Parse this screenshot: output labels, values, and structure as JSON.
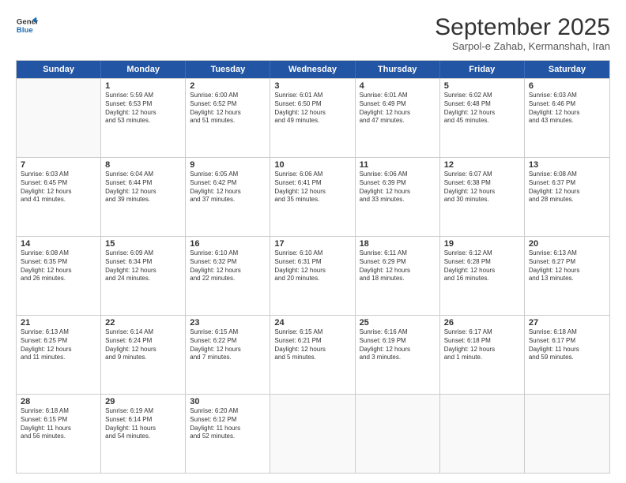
{
  "header": {
    "logo_line1": "General",
    "logo_line2": "Blue",
    "month": "September 2025",
    "location": "Sarpol-e Zahab, Kermanshah, Iran"
  },
  "weekdays": [
    "Sunday",
    "Monday",
    "Tuesday",
    "Wednesday",
    "Thursday",
    "Friday",
    "Saturday"
  ],
  "rows": [
    [
      {
        "day": "",
        "lines": []
      },
      {
        "day": "1",
        "lines": [
          "Sunrise: 5:59 AM",
          "Sunset: 6:53 PM",
          "Daylight: 12 hours",
          "and 53 minutes."
        ]
      },
      {
        "day": "2",
        "lines": [
          "Sunrise: 6:00 AM",
          "Sunset: 6:52 PM",
          "Daylight: 12 hours",
          "and 51 minutes."
        ]
      },
      {
        "day": "3",
        "lines": [
          "Sunrise: 6:01 AM",
          "Sunset: 6:50 PM",
          "Daylight: 12 hours",
          "and 49 minutes."
        ]
      },
      {
        "day": "4",
        "lines": [
          "Sunrise: 6:01 AM",
          "Sunset: 6:49 PM",
          "Daylight: 12 hours",
          "and 47 minutes."
        ]
      },
      {
        "day": "5",
        "lines": [
          "Sunrise: 6:02 AM",
          "Sunset: 6:48 PM",
          "Daylight: 12 hours",
          "and 45 minutes."
        ]
      },
      {
        "day": "6",
        "lines": [
          "Sunrise: 6:03 AM",
          "Sunset: 6:46 PM",
          "Daylight: 12 hours",
          "and 43 minutes."
        ]
      }
    ],
    [
      {
        "day": "7",
        "lines": [
          "Sunrise: 6:03 AM",
          "Sunset: 6:45 PM",
          "Daylight: 12 hours",
          "and 41 minutes."
        ]
      },
      {
        "day": "8",
        "lines": [
          "Sunrise: 6:04 AM",
          "Sunset: 6:44 PM",
          "Daylight: 12 hours",
          "and 39 minutes."
        ]
      },
      {
        "day": "9",
        "lines": [
          "Sunrise: 6:05 AM",
          "Sunset: 6:42 PM",
          "Daylight: 12 hours",
          "and 37 minutes."
        ]
      },
      {
        "day": "10",
        "lines": [
          "Sunrise: 6:06 AM",
          "Sunset: 6:41 PM",
          "Daylight: 12 hours",
          "and 35 minutes."
        ]
      },
      {
        "day": "11",
        "lines": [
          "Sunrise: 6:06 AM",
          "Sunset: 6:39 PM",
          "Daylight: 12 hours",
          "and 33 minutes."
        ]
      },
      {
        "day": "12",
        "lines": [
          "Sunrise: 6:07 AM",
          "Sunset: 6:38 PM",
          "Daylight: 12 hours",
          "and 30 minutes."
        ]
      },
      {
        "day": "13",
        "lines": [
          "Sunrise: 6:08 AM",
          "Sunset: 6:37 PM",
          "Daylight: 12 hours",
          "and 28 minutes."
        ]
      }
    ],
    [
      {
        "day": "14",
        "lines": [
          "Sunrise: 6:08 AM",
          "Sunset: 6:35 PM",
          "Daylight: 12 hours",
          "and 26 minutes."
        ]
      },
      {
        "day": "15",
        "lines": [
          "Sunrise: 6:09 AM",
          "Sunset: 6:34 PM",
          "Daylight: 12 hours",
          "and 24 minutes."
        ]
      },
      {
        "day": "16",
        "lines": [
          "Sunrise: 6:10 AM",
          "Sunset: 6:32 PM",
          "Daylight: 12 hours",
          "and 22 minutes."
        ]
      },
      {
        "day": "17",
        "lines": [
          "Sunrise: 6:10 AM",
          "Sunset: 6:31 PM",
          "Daylight: 12 hours",
          "and 20 minutes."
        ]
      },
      {
        "day": "18",
        "lines": [
          "Sunrise: 6:11 AM",
          "Sunset: 6:29 PM",
          "Daylight: 12 hours",
          "and 18 minutes."
        ]
      },
      {
        "day": "19",
        "lines": [
          "Sunrise: 6:12 AM",
          "Sunset: 6:28 PM",
          "Daylight: 12 hours",
          "and 16 minutes."
        ]
      },
      {
        "day": "20",
        "lines": [
          "Sunrise: 6:13 AM",
          "Sunset: 6:27 PM",
          "Daylight: 12 hours",
          "and 13 minutes."
        ]
      }
    ],
    [
      {
        "day": "21",
        "lines": [
          "Sunrise: 6:13 AM",
          "Sunset: 6:25 PM",
          "Daylight: 12 hours",
          "and 11 minutes."
        ]
      },
      {
        "day": "22",
        "lines": [
          "Sunrise: 6:14 AM",
          "Sunset: 6:24 PM",
          "Daylight: 12 hours",
          "and 9 minutes."
        ]
      },
      {
        "day": "23",
        "lines": [
          "Sunrise: 6:15 AM",
          "Sunset: 6:22 PM",
          "Daylight: 12 hours",
          "and 7 minutes."
        ]
      },
      {
        "day": "24",
        "lines": [
          "Sunrise: 6:15 AM",
          "Sunset: 6:21 PM",
          "Daylight: 12 hours",
          "and 5 minutes."
        ]
      },
      {
        "day": "25",
        "lines": [
          "Sunrise: 6:16 AM",
          "Sunset: 6:19 PM",
          "Daylight: 12 hours",
          "and 3 minutes."
        ]
      },
      {
        "day": "26",
        "lines": [
          "Sunrise: 6:17 AM",
          "Sunset: 6:18 PM",
          "Daylight: 12 hours",
          "and 1 minute."
        ]
      },
      {
        "day": "27",
        "lines": [
          "Sunrise: 6:18 AM",
          "Sunset: 6:17 PM",
          "Daylight: 11 hours",
          "and 59 minutes."
        ]
      }
    ],
    [
      {
        "day": "28",
        "lines": [
          "Sunrise: 6:18 AM",
          "Sunset: 6:15 PM",
          "Daylight: 11 hours",
          "and 56 minutes."
        ]
      },
      {
        "day": "29",
        "lines": [
          "Sunrise: 6:19 AM",
          "Sunset: 6:14 PM",
          "Daylight: 11 hours",
          "and 54 minutes."
        ]
      },
      {
        "day": "30",
        "lines": [
          "Sunrise: 6:20 AM",
          "Sunset: 6:12 PM",
          "Daylight: 11 hours",
          "and 52 minutes."
        ]
      },
      {
        "day": "",
        "lines": []
      },
      {
        "day": "",
        "lines": []
      },
      {
        "day": "",
        "lines": []
      },
      {
        "day": "",
        "lines": []
      }
    ]
  ]
}
